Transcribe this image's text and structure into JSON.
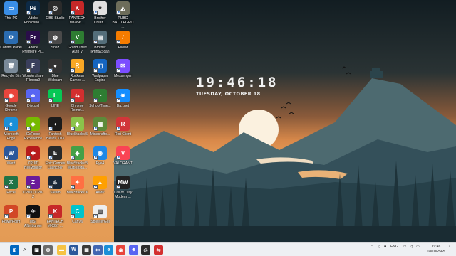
{
  "desktop_icons": [
    {
      "label": "This PC",
      "icon": "this-pc-icon",
      "color": "#3a8ee6",
      "glyph": "▭"
    },
    {
      "label": "Control Panel",
      "icon": "control-panel-icon",
      "color": "#2b6cb0",
      "glyph": "⚙"
    },
    {
      "label": "Recycle Bin",
      "icon": "recycle-bin-icon",
      "color": "#7a8a99",
      "glyph": "🗑"
    },
    {
      "label": "Google Chrome",
      "icon": "chrome-icon",
      "color": "#e8453c",
      "glyph": "◉"
    },
    {
      "label": "Microsoft Edge",
      "icon": "edge-icon",
      "color": "#1a8fd8",
      "glyph": "e"
    },
    {
      "label": "Word",
      "icon": "word-icon",
      "color": "#2b579a",
      "glyph": "W"
    },
    {
      "label": "Excel",
      "icon": "excel-icon",
      "color": "#217346",
      "glyph": "X"
    },
    {
      "label": "PowerPoint",
      "icon": "powerpoint-icon",
      "color": "#d24726",
      "glyph": "P"
    },
    {
      "label": "Adobe Photosho...",
      "icon": "photoshop-icon",
      "color": "#0d2a46",
      "glyph": "Ps"
    },
    {
      "label": "Adobe Premiere Pr...",
      "icon": "premiere-icon",
      "color": "#2a0e4a",
      "glyph": "Pr"
    },
    {
      "label": "Wondershare Filmora9",
      "icon": "filmora-icon",
      "color": "#3a3f5c",
      "glyph": "F"
    },
    {
      "label": "Discord",
      "icon": "discord-icon",
      "color": "#5865f2",
      "glyph": "☻"
    },
    {
      "label": "GeForce Experience",
      "icon": "geforce-icon",
      "color": "#76b900",
      "glyph": "◈"
    },
    {
      "label": "CPUID HWMonitor",
      "icon": "hwmonitor-icon",
      "color": "#b71c1c",
      "glyph": "✚"
    },
    {
      "label": "CPUID CPU-Z",
      "icon": "cpuz-icon",
      "color": "#6a1b9a",
      "glyph": "Z"
    },
    {
      "label": "MSI Afterburner",
      "icon": "afterburner-icon",
      "color": "#111111",
      "glyph": "✈"
    },
    {
      "label": "OBS Studio",
      "icon": "obs-icon",
      "color": "#2b2b2b",
      "glyph": "◎"
    },
    {
      "label": "Snaz",
      "icon": "snaz-icon",
      "color": "#4a4a4a",
      "glyph": "◍"
    },
    {
      "label": "Blue Webcam",
      "icon": "webcam-icon",
      "color": "#333333",
      "glyph": "●"
    },
    {
      "label": "LINE",
      "icon": "line-icon",
      "color": "#06c755",
      "glyph": "L"
    },
    {
      "label": "Fantech Helios XD3",
      "icon": "fantech-mouse-icon",
      "color": "#1b1b1b",
      "glyph": "◖"
    },
    {
      "label": "Epic Games Launcher",
      "icon": "epic-games-icon",
      "color": "#2a2a2a",
      "glyph": "E"
    },
    {
      "label": "Steam",
      "icon": "steam-icon",
      "color": "#1b2838",
      "glyph": "♨"
    },
    {
      "label": "FANTECH MK857 ...",
      "icon": "fantech-keyboard-icon",
      "color": "#c62828",
      "glyph": "K"
    },
    {
      "label": "FANTECH MK856 ...",
      "icon": "fantech-keyboard-icon",
      "color": "#c62828",
      "glyph": "K"
    },
    {
      "label": "Grand Theft Auto V",
      "icon": "gta-icon",
      "color": "#2e7d32",
      "glyph": "V"
    },
    {
      "label": "Rockstar Games ...",
      "icon": "rockstar-icon",
      "color": "#f9a825",
      "glyph": "R"
    },
    {
      "label": "Chrome Remot...",
      "icon": "chrome-remote-icon",
      "color": "#d32f2f",
      "glyph": "⇆"
    },
    {
      "label": "BlueStacks 5",
      "icon": "bluestacks-icon",
      "color": "#8bc34a",
      "glyph": "◆"
    },
    {
      "label": "BlueStacks 5 Multi-Insta...",
      "icon": "bluestacks-multi-icon",
      "color": "#43a047",
      "glyph": "◆"
    },
    {
      "label": "BlueStacks X",
      "icon": "bluestacks-x-icon",
      "color": "#ff7043",
      "glyph": "✦"
    },
    {
      "label": "Canva",
      "icon": "canva-icon",
      "color": "#00c4cc",
      "glyph": "C"
    },
    {
      "label": "Brother Creati...",
      "icon": "brother-icon",
      "color": "#e0e0e0",
      "glyph": "♥"
    },
    {
      "label": "Brother iPrint&Scan",
      "icon": "iprint-icon",
      "color": "#546e7a",
      "glyph": "▤"
    },
    {
      "label": "Wallpaper Engine",
      "icon": "wallpaper-engine-icon",
      "color": "#1565c0",
      "glyph": "◧"
    },
    {
      "label": "SchoolTime...",
      "icon": "schooltime-icon",
      "color": "#2e7d32",
      "glyph": "◔"
    },
    {
      "label": "Minecraftb...",
      "icon": "minecraft-icon",
      "color": "#5d8a3a",
      "glyph": "▦"
    },
    {
      "label": "Eye4",
      "icon": "eye4-icon",
      "color": "#1e88e5",
      "glyph": "◉"
    },
    {
      "label": "AIMP",
      "icon": "aimp-icon",
      "color": "#ffa000",
      "glyph": "▲"
    },
    {
      "label": "SpleeterGui",
      "icon": "spleeter-icon",
      "color": "#eeeeee",
      "glyph": "▥"
    },
    {
      "label": "PUBG BATTLEGRO...",
      "icon": "pubg-icon",
      "color": "#6d6d5a",
      "glyph": "◭"
    },
    {
      "label": "FiveM",
      "icon": "fivem-icon",
      "color": "#f57c00",
      "glyph": "/"
    },
    {
      "label": "Messenger",
      "icon": "messenger-icon",
      "color": "#7b4dff",
      "glyph": "✉"
    },
    {
      "label": "Ba...net",
      "icon": "battlenet-icon",
      "color": "#148eff",
      "glyph": "✸"
    },
    {
      "label": "Riot Client",
      "icon": "riot-icon",
      "color": "#d13639",
      "glyph": "R"
    },
    {
      "label": "VALORANT",
      "icon": "valorant-icon",
      "color": "#fa4454",
      "glyph": "V"
    },
    {
      "label": "Call of Duty Modern ...",
      "icon": "cod-icon",
      "color": "#222222",
      "glyph": "MW"
    }
  ],
  "clock_widget": {
    "time": "19:46:18",
    "date": "TUESDAY, OCTOBER 18"
  },
  "taskbar": {
    "items": [
      {
        "name": "start-button-icon",
        "color": "#0067c0",
        "glyph": "⊞",
        "active": false
      },
      {
        "name": "search-icon",
        "color": "#eef0f3",
        "glyph": "⌕",
        "active": false
      },
      {
        "name": "task-view-icon",
        "color": "#1f1f1f",
        "glyph": "▣",
        "active": false
      },
      {
        "name": "settings-icon",
        "color": "#6b6b6b",
        "glyph": "⚙",
        "active": false
      },
      {
        "name": "file-explorer-icon",
        "color": "#f6c344",
        "glyph": "▬",
        "active": true
      },
      {
        "name": "word-taskbar-icon",
        "color": "#2b579a",
        "glyph": "W",
        "active": false
      },
      {
        "name": "calculator-icon",
        "color": "#3a3a3a",
        "glyph": "▦",
        "active": false
      },
      {
        "name": "snipping-tool-icon",
        "color": "#4267b2",
        "glyph": "✂",
        "active": false
      },
      {
        "name": "edge-taskbar-icon",
        "color": "#1a8fd8",
        "glyph": "e",
        "active": true
      },
      {
        "name": "chrome-taskbar-icon",
        "color": "#e8453c",
        "glyph": "◉",
        "active": true
      },
      {
        "name": "discord-taskbar-icon",
        "color": "#5865f2",
        "glyph": "☻",
        "active": false
      },
      {
        "name": "obs-taskbar-icon",
        "color": "#2b2b2b",
        "glyph": "◎",
        "active": false
      },
      {
        "name": "chrome-remote-taskbar-icon",
        "color": "#d32f2f",
        "glyph": "⇆",
        "active": false
      }
    ],
    "tray": {
      "language": "ENG",
      "time": "19:46",
      "date": "18/10/2565"
    }
  }
}
